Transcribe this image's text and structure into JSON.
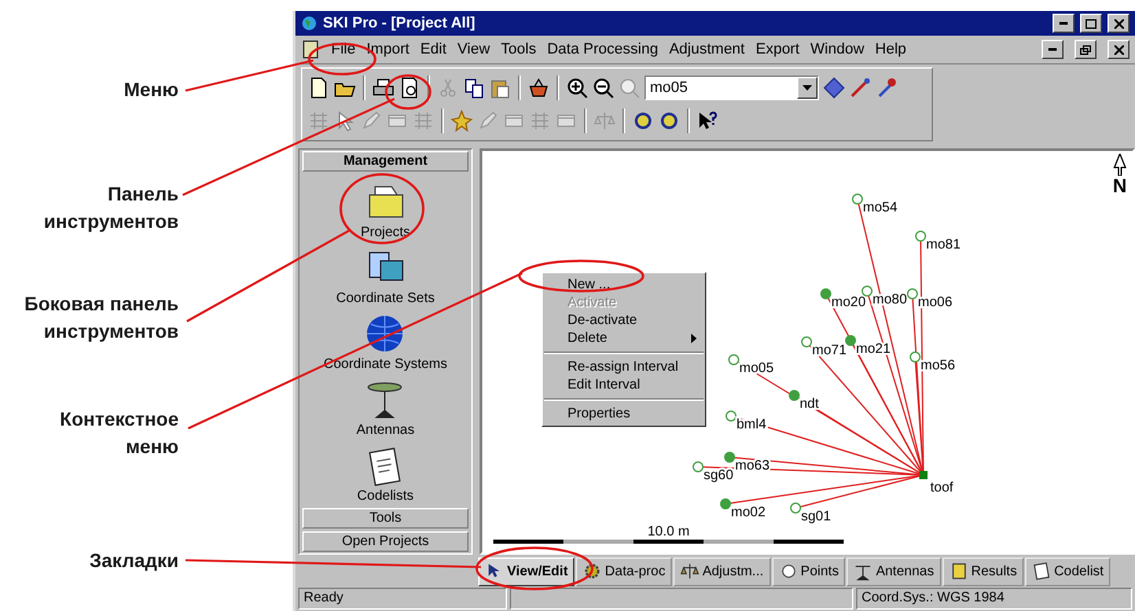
{
  "annotations": [
    {
      "lines": [
        "Меню"
      ]
    },
    {
      "lines": [
        "Панель",
        "инструментов"
      ]
    },
    {
      "lines": [
        "Боковая панель",
        "инструментов"
      ]
    },
    {
      "lines": [
        "Контекстное",
        "меню"
      ]
    },
    {
      "lines": [
        "Закладки"
      ]
    }
  ],
  "window": {
    "title": "SKI Pro - [Project All]"
  },
  "menu": [
    {
      "label": "File"
    },
    {
      "label": "Import"
    },
    {
      "label": "Edit"
    },
    {
      "label": "View"
    },
    {
      "label": "Tools"
    },
    {
      "label": "Data Processing"
    },
    {
      "label": "Adjustment"
    },
    {
      "label": "Export"
    },
    {
      "label": "Window"
    },
    {
      "label": "Help"
    }
  ],
  "toolbar": {
    "combo_value": "mo05"
  },
  "sidebar": {
    "header": "Management",
    "items": [
      {
        "label": "Projects",
        "kind": "projects"
      },
      {
        "label": "Coordinate Sets",
        "kind": "sets"
      },
      {
        "label": "Coordinate Systems",
        "kind": "systems"
      },
      {
        "label": "Antennas",
        "kind": "antennas"
      },
      {
        "label": "Codelists",
        "kind": "codelists"
      }
    ],
    "buttons": [
      "Tools",
      "Open Projects"
    ]
  },
  "map": {
    "north_label": "N",
    "scale_label": "10.0 m",
    "base": {
      "label": "toof"
    },
    "points": [
      {
        "label": "mo54",
        "filled": false
      },
      {
        "label": "mo81",
        "filled": false
      },
      {
        "label": "mo20",
        "filled": true
      },
      {
        "label": "mo80",
        "filled": false
      },
      {
        "label": "mo06",
        "filled": false
      },
      {
        "label": "mo21",
        "filled": true
      },
      {
        "label": "mo71",
        "filled": false
      },
      {
        "label": "mo56",
        "filled": false
      },
      {
        "label": "mo05",
        "filled": false
      },
      {
        "label": "ndt",
        "filled": true
      },
      {
        "label": "bml4",
        "filled": false
      },
      {
        "label": "mo63",
        "filled": true
      },
      {
        "label": "sg60",
        "filled": false
      },
      {
        "label": "mo02",
        "filled": true
      },
      {
        "label": "sg01",
        "filled": false
      }
    ]
  },
  "context_menu": {
    "groups": [
      [
        {
          "label": "New ...",
          "disabled": false,
          "submenu": false
        },
        {
          "label": "Activate",
          "disabled": true,
          "submenu": false
        },
        {
          "label": "De-activate",
          "disabled": false,
          "submenu": false
        },
        {
          "label": "Delete",
          "disabled": false,
          "submenu": true
        }
      ],
      [
        {
          "label": "Re-assign Interval",
          "disabled": false,
          "submenu": false
        },
        {
          "label": "Edit Interval",
          "disabled": false,
          "submenu": false
        }
      ],
      [
        {
          "label": "Properties",
          "disabled": false,
          "submenu": false
        }
      ]
    ]
  },
  "tabs": [
    {
      "label": "View/Edit",
      "selected": true,
      "kind": "view"
    },
    {
      "label": "Data-proc",
      "selected": false,
      "kind": "proc"
    },
    {
      "label": "Adjustm...",
      "selected": false,
      "kind": "adjust"
    },
    {
      "label": "Points",
      "selected": false,
      "kind": "points"
    },
    {
      "label": "Antennas",
      "selected": false,
      "kind": "antennas"
    },
    {
      "label": "Results",
      "selected": false,
      "kind": "results"
    },
    {
      "label": "Codelist",
      "selected": false,
      "kind": "codelist"
    }
  ],
  "status_bar": {
    "message": "Ready",
    "coord_sys": "Coord.Sys.: WGS 1984"
  }
}
